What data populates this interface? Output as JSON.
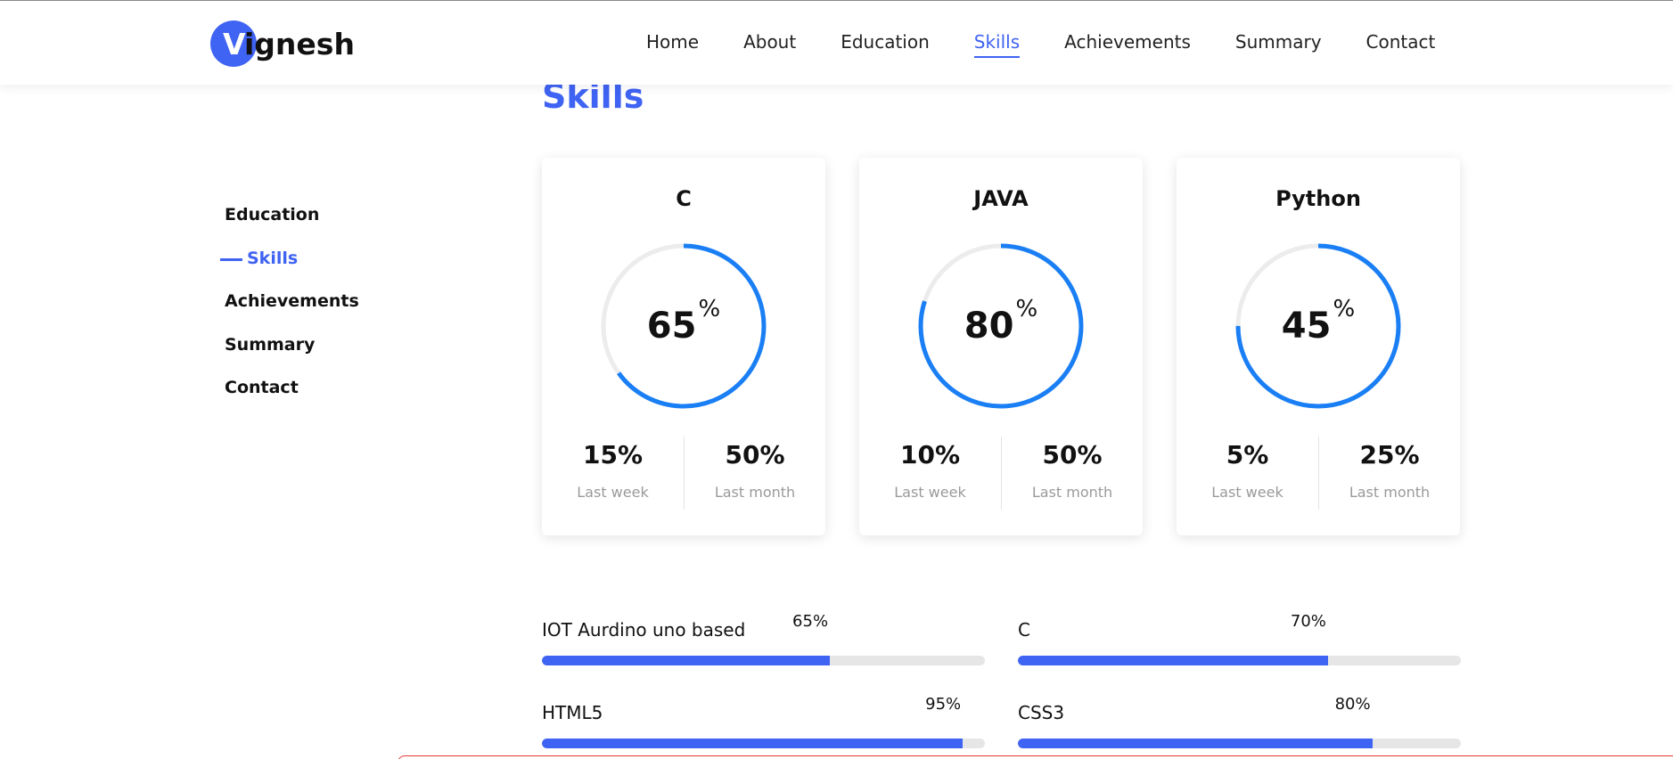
{
  "header": {
    "logo_initial": "V",
    "logo_rest": "ignesh",
    "nav": [
      {
        "label": "Home",
        "active": false
      },
      {
        "label": "About",
        "active": false
      },
      {
        "label": "Education",
        "active": false
      },
      {
        "label": "Skills",
        "active": true
      },
      {
        "label": "Achievements",
        "active": false
      },
      {
        "label": "Summary",
        "active": false
      },
      {
        "label": "Contact",
        "active": false
      }
    ]
  },
  "sidebar": {
    "items": [
      {
        "label": "Education",
        "active": false
      },
      {
        "label": "Skills",
        "active": true
      },
      {
        "label": "Achievements",
        "active": false
      },
      {
        "label": "Summary",
        "active": false
      },
      {
        "label": "Contact",
        "active": false
      }
    ]
  },
  "section": {
    "title": "Skills"
  },
  "cards": [
    {
      "title": "C",
      "percent": 65,
      "percent_label": "65",
      "pct_symbol": "%",
      "week_value": "15%",
      "week_label": "Last week",
      "month_value": "50%",
      "month_label": "Last month"
    },
    {
      "title": "JAVA",
      "percent": 80,
      "percent_label": "80",
      "pct_symbol": "%",
      "week_value": "10%",
      "week_label": "Last week",
      "month_value": "50%",
      "month_label": "Last month"
    },
    {
      "title": "Python",
      "percent": 75,
      "percent_label": "45",
      "pct_symbol": "%",
      "week_value": "5%",
      "week_label": "Last week",
      "month_value": "25%",
      "month_label": "Last month"
    }
  ],
  "bars": [
    {
      "label": "IOT Aurdino uno based",
      "value": 65,
      "value_label": "65%"
    },
    {
      "label": "C",
      "value": 70,
      "value_label": "70%"
    },
    {
      "label": "HTML5",
      "value": 95,
      "value_label": "95%"
    },
    {
      "label": "CSS3",
      "value": 80,
      "value_label": "80%"
    }
  ],
  "colors": {
    "accent": "#3f63f2",
    "ring": "#1a7ff5",
    "ring_track": "#ececec",
    "bar_track": "#e6e6e6"
  }
}
